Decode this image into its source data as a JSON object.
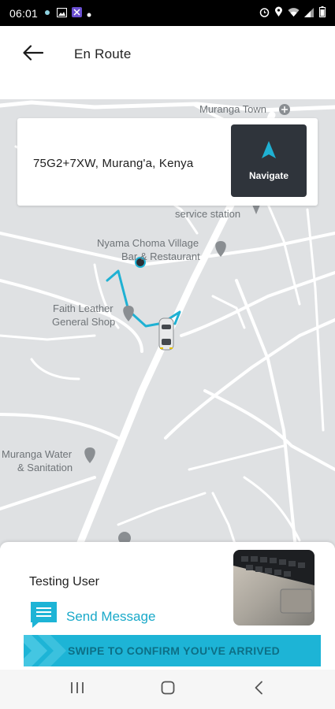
{
  "status_bar": {
    "time": "06:01",
    "left_icons": [
      "notification-icon",
      "gallery-icon",
      "app-icon",
      "dot-icon"
    ],
    "right_icons": [
      "alarm-icon",
      "location-icon",
      "wifi-icon",
      "signal-icon",
      "battery-icon"
    ]
  },
  "header": {
    "title": "En Route",
    "back_icon": "arrow-left-icon"
  },
  "map": {
    "labels": {
      "muranga_town": "Muranga Town",
      "service_station": "service station",
      "nyama_choma_1": "Nyama Choma Village",
      "nyama_choma_2": "Bar & Restaurant",
      "faith_leather_1": "Faith Leather",
      "faith_leather_2": "General Shop",
      "muranga_water_1": "Muranga Water",
      "muranga_water_2": "& Sanitation"
    },
    "colors": {
      "background": "#dfe1e3",
      "roads": "#ffffff",
      "route": "#1fb1d3"
    }
  },
  "destination": {
    "address": "75G2+7XW, Murang'a, Kenya",
    "navigate_label": "Navigate",
    "navigate_icon": "navigation-arrow-icon"
  },
  "rider": {
    "name": "Testing User",
    "message_label": "Send Message",
    "message_icon": "chat-icon"
  },
  "swipe": {
    "label": "SWIPE TO CONFIRM YOU'VE ARRIVED",
    "color": "#1db4d6"
  },
  "nav_bar": {
    "icons": [
      "recent-apps-icon",
      "home-icon",
      "back-icon"
    ]
  }
}
